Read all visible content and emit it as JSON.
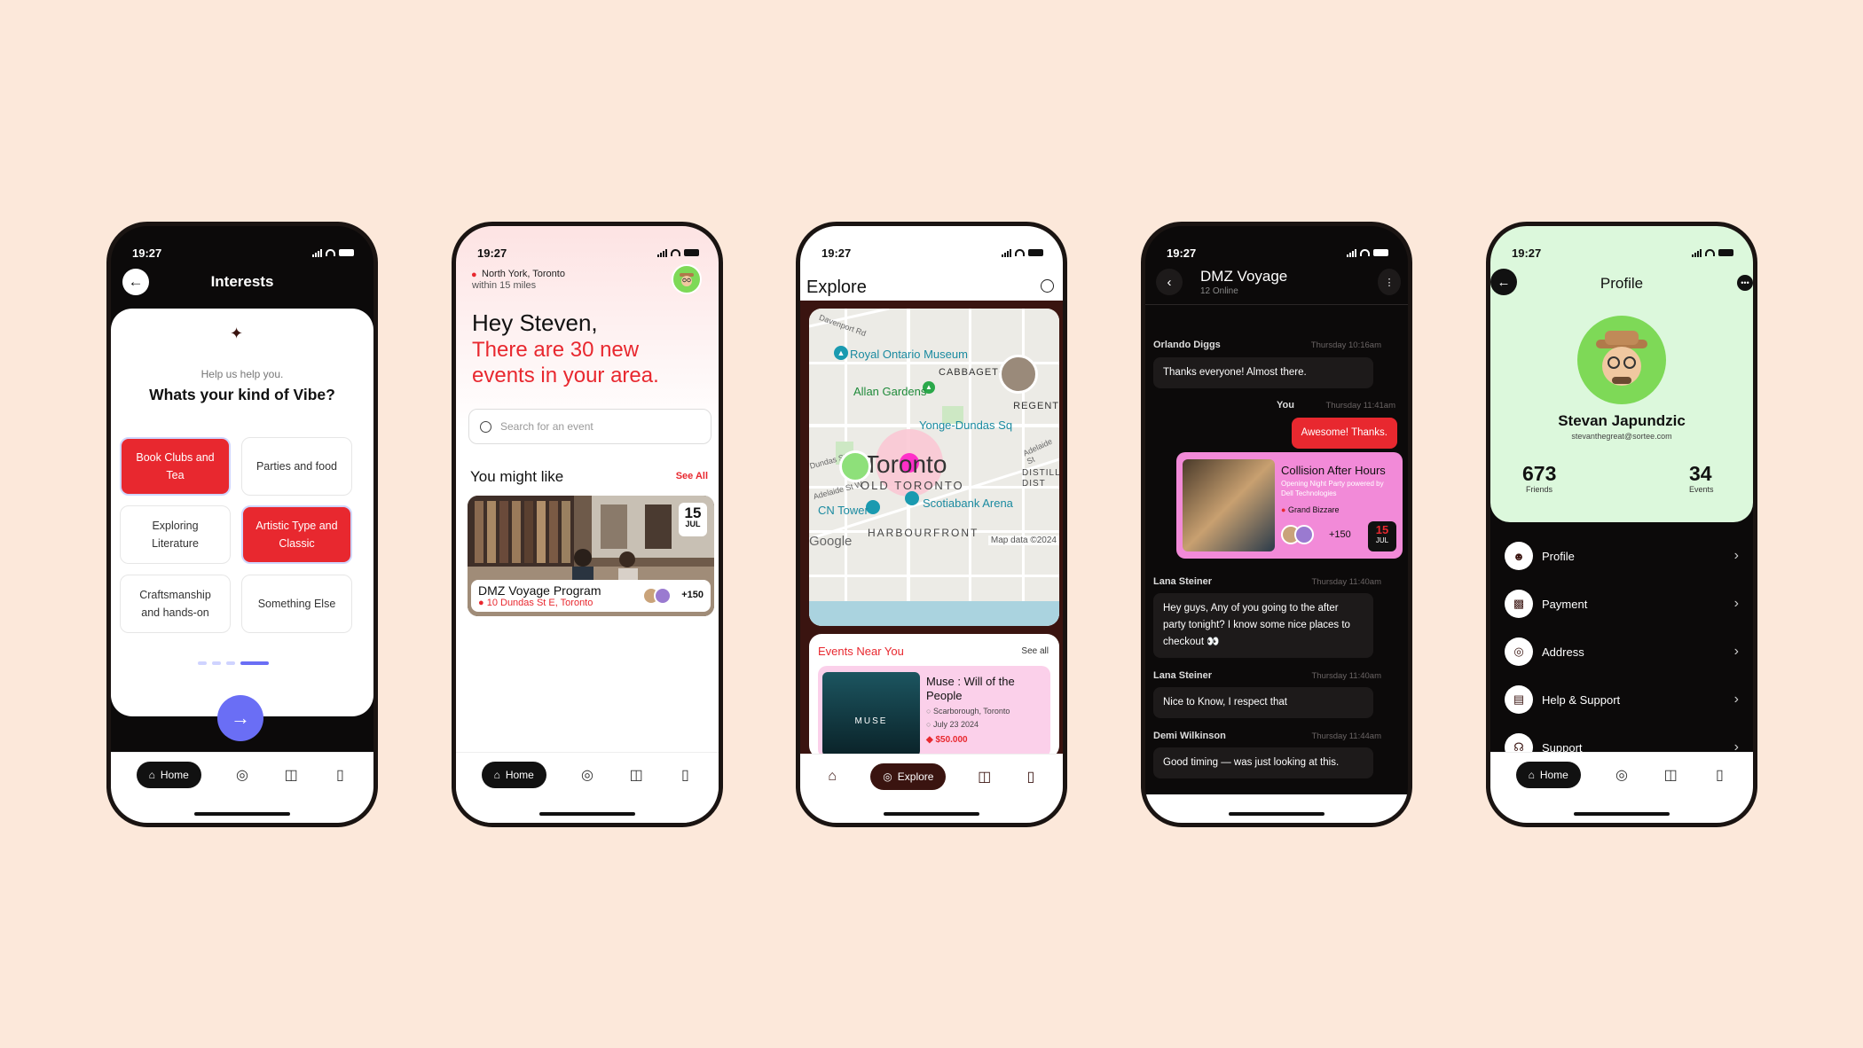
{
  "status": {
    "time": "19:27"
  },
  "nav": {
    "home": "Home",
    "explore": "Explore"
  },
  "interests": {
    "title": "Interests",
    "help": "Help us help you.",
    "question": "Whats your kind of Vibe?",
    "chips": [
      {
        "label": "Book Clubs and Tea",
        "selected": true
      },
      {
        "label": "Parties and food",
        "selected": false
      },
      {
        "label": "Exploring Literature",
        "selected": false
      },
      {
        "label": "Artistic Type and Classic",
        "selected": true
      },
      {
        "label": "Craftsmanship and hands-on",
        "selected": false
      },
      {
        "label": "Something Else",
        "selected": false
      }
    ],
    "page_dots": 4,
    "active_dot": 4
  },
  "home": {
    "location": "North York, Toronto",
    "radius": "within 15 miles",
    "greeting": "Hey Steven,",
    "headline_1": "There are 30 new",
    "headline_2": "events in your area.",
    "search_placeholder": "Search for an event",
    "section": "You might like",
    "see_all": "See All",
    "event": {
      "day": "15",
      "month": "JUL",
      "title": "DMZ Voyage Program",
      "address": "10 Dundas St E, Toronto",
      "attendees": "+150"
    }
  },
  "explore": {
    "title": "Explore",
    "map": {
      "city": "Toronto",
      "labels": [
        "Royal Ontario Museum",
        "Allan Gardens",
        "CABBAGETOWN",
        "Yonge-Dundas Sq",
        "OLD TORONTO",
        "CN Tower",
        "Scotiabank Arena",
        "HARBOURFRONT",
        "DISTILLERY DIST",
        "REGENT",
        "Davenport Rd",
        "Adelaide St W",
        "Dundas St W",
        "Adelaide St",
        "Map data ©2024",
        "Google"
      ]
    },
    "near_title": "Events Near You",
    "see_all": "See all",
    "event": {
      "title": "Muse : Will of the People",
      "location": "Scarborough, Toronto",
      "date": "July 23 2024",
      "price": "$50.000",
      "poster_text": "MUSE"
    }
  },
  "chat": {
    "title": "DMZ Voyage",
    "online": "12 Online",
    "messages": [
      {
        "name": "Orlando Diggs",
        "time": "Thursday 10:16am",
        "text": "Thanks everyone! Almost there."
      },
      {
        "name": "You",
        "time": "Thursday 11:41am",
        "text": "Awesome! Thanks."
      },
      {
        "name": "Lana Steiner",
        "time": "Thursday 11:40am",
        "text": "Hey guys, Any of you going to the after party tonight? I know some nice places to checkout 👀"
      },
      {
        "name": "Lana Steiner",
        "time": "Thursday 11:40am",
        "text": "Nice to Know, I respect that"
      },
      {
        "name": "Demi Wilkinson",
        "time": "Thursday 11:44am",
        "text": "Good timing — was just looking at this."
      }
    ],
    "card": {
      "title": "Collision After Hours",
      "subtitle": "Opening Night Party powered by Dell Technologies",
      "venue": "Grand Bizzare",
      "attendees": "+150",
      "day": "15",
      "month": "JUL"
    },
    "colors": {
      "accent": "#E8282F",
      "card": "#F28AD8"
    }
  },
  "profile": {
    "title": "Profile",
    "name": "Stevan Japundzic",
    "email": "stevanthegreat@sortee.com",
    "friends": "673",
    "friends_label": "Friends",
    "events": "34",
    "events_label": "Events",
    "menu": [
      "Profile",
      "Payment",
      "Address",
      "Help & Support",
      "Support"
    ]
  }
}
